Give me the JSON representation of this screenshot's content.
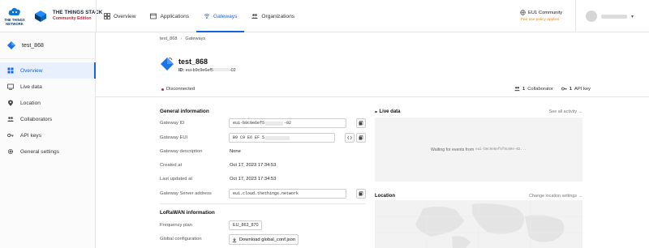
{
  "brand": {
    "ttn_logo_text": "THE THINGS NETWORK",
    "stack_title": "THE THINGS STACK",
    "stack_edition": "Community Edition"
  },
  "nav": [
    {
      "label": "Overview",
      "icon": "overview-icon",
      "active": false
    },
    {
      "label": "Applications",
      "icon": "applications-icon",
      "active": false
    },
    {
      "label": "Gateways",
      "icon": "gateways-icon",
      "active": true
    },
    {
      "label": "Organizations",
      "icon": "organizations-icon",
      "active": false
    }
  ],
  "cluster": {
    "name": "EU1 Community",
    "fair_use": "Fair use policy applies"
  },
  "sidebar": {
    "entity_name": "test_868",
    "items": [
      {
        "label": "Overview",
        "icon": "overview-icon",
        "active": true
      },
      {
        "label": "Live data",
        "icon": "live-data-icon",
        "active": false
      },
      {
        "label": "Location",
        "icon": "location-pin-icon",
        "active": false
      },
      {
        "label": "Collaborators",
        "icon": "collaborators-icon",
        "active": false
      },
      {
        "label": "API keys",
        "icon": "key-icon",
        "active": false
      },
      {
        "label": "General settings",
        "icon": "gear-icon",
        "active": false
      }
    ]
  },
  "breadcrumb": {
    "first": "test_868",
    "second": "Gateways"
  },
  "gateway": {
    "title": "test_868",
    "id_label": "ID:",
    "id_prefix": "eui-b9c9e6ef5",
    "id_suffix": "-02"
  },
  "status": {
    "connection": "Disconnected",
    "collaborators_count": "1",
    "collaborators_label": "Collaborator",
    "api_keys_count": "1",
    "api_keys_label": "API key"
  },
  "general": {
    "title": "General information",
    "gateway_id_label": "Gateway ID",
    "gateway_id_prefix": "eui-b9c9e6ef5",
    "gateway_id_suffix": "-02",
    "gateway_eui_label": "Gateway EUI",
    "gateway_eui_value": "B9 C9 E6 EF 5",
    "description_label": "Gateway description",
    "description_value": "None",
    "created_label": "Created at",
    "created_value": "Oct 17, 2023 17:34:53",
    "updated_label": "Last updated at",
    "updated_value": "Oct 17, 2023 17:34:53",
    "server_label": "Gateway Server address",
    "server_value": "eu1.cloud.thethings.network"
  },
  "lorawan": {
    "title": "LoRaWAN information",
    "freq_label": "Frequency plan",
    "freq_value": "EU_863_870",
    "global_conf_label": "Global configuration",
    "download_label": "Download global_conf.json"
  },
  "live_data": {
    "title": "Live data",
    "see_all": "See all activity →",
    "waiting_text": "Waiting for events from",
    "waiting_id": "eui-b9c9e6ef5f9c89e-02..."
  },
  "location": {
    "title": "Location",
    "change": "Change location settings →"
  }
}
